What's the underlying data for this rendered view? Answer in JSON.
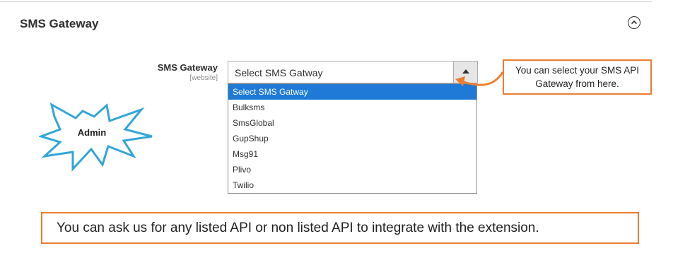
{
  "section": {
    "title": "SMS Gateway",
    "collapse_icon": "chevron-up-circle-icon"
  },
  "field": {
    "label": "SMS Gateway",
    "scope": "[website]"
  },
  "select": {
    "value": "Select SMS Gatway",
    "options": [
      "Select SMS Gatway",
      "Bulksms",
      "SmsGlobal",
      "GupShup",
      "Msg91",
      "Plivo",
      "Twilio"
    ],
    "selected_index": 0,
    "highlight_color": "#1e7ad6"
  },
  "annotations": {
    "starburst_text": "Admin",
    "callout_text": "You can select your SMS API Gateway from here.",
    "note_text": "You can ask us for any listed API or non listed API to integrate with the extension.",
    "accent_color": "#ed7d31",
    "starburst_color": "#32a6d8"
  }
}
